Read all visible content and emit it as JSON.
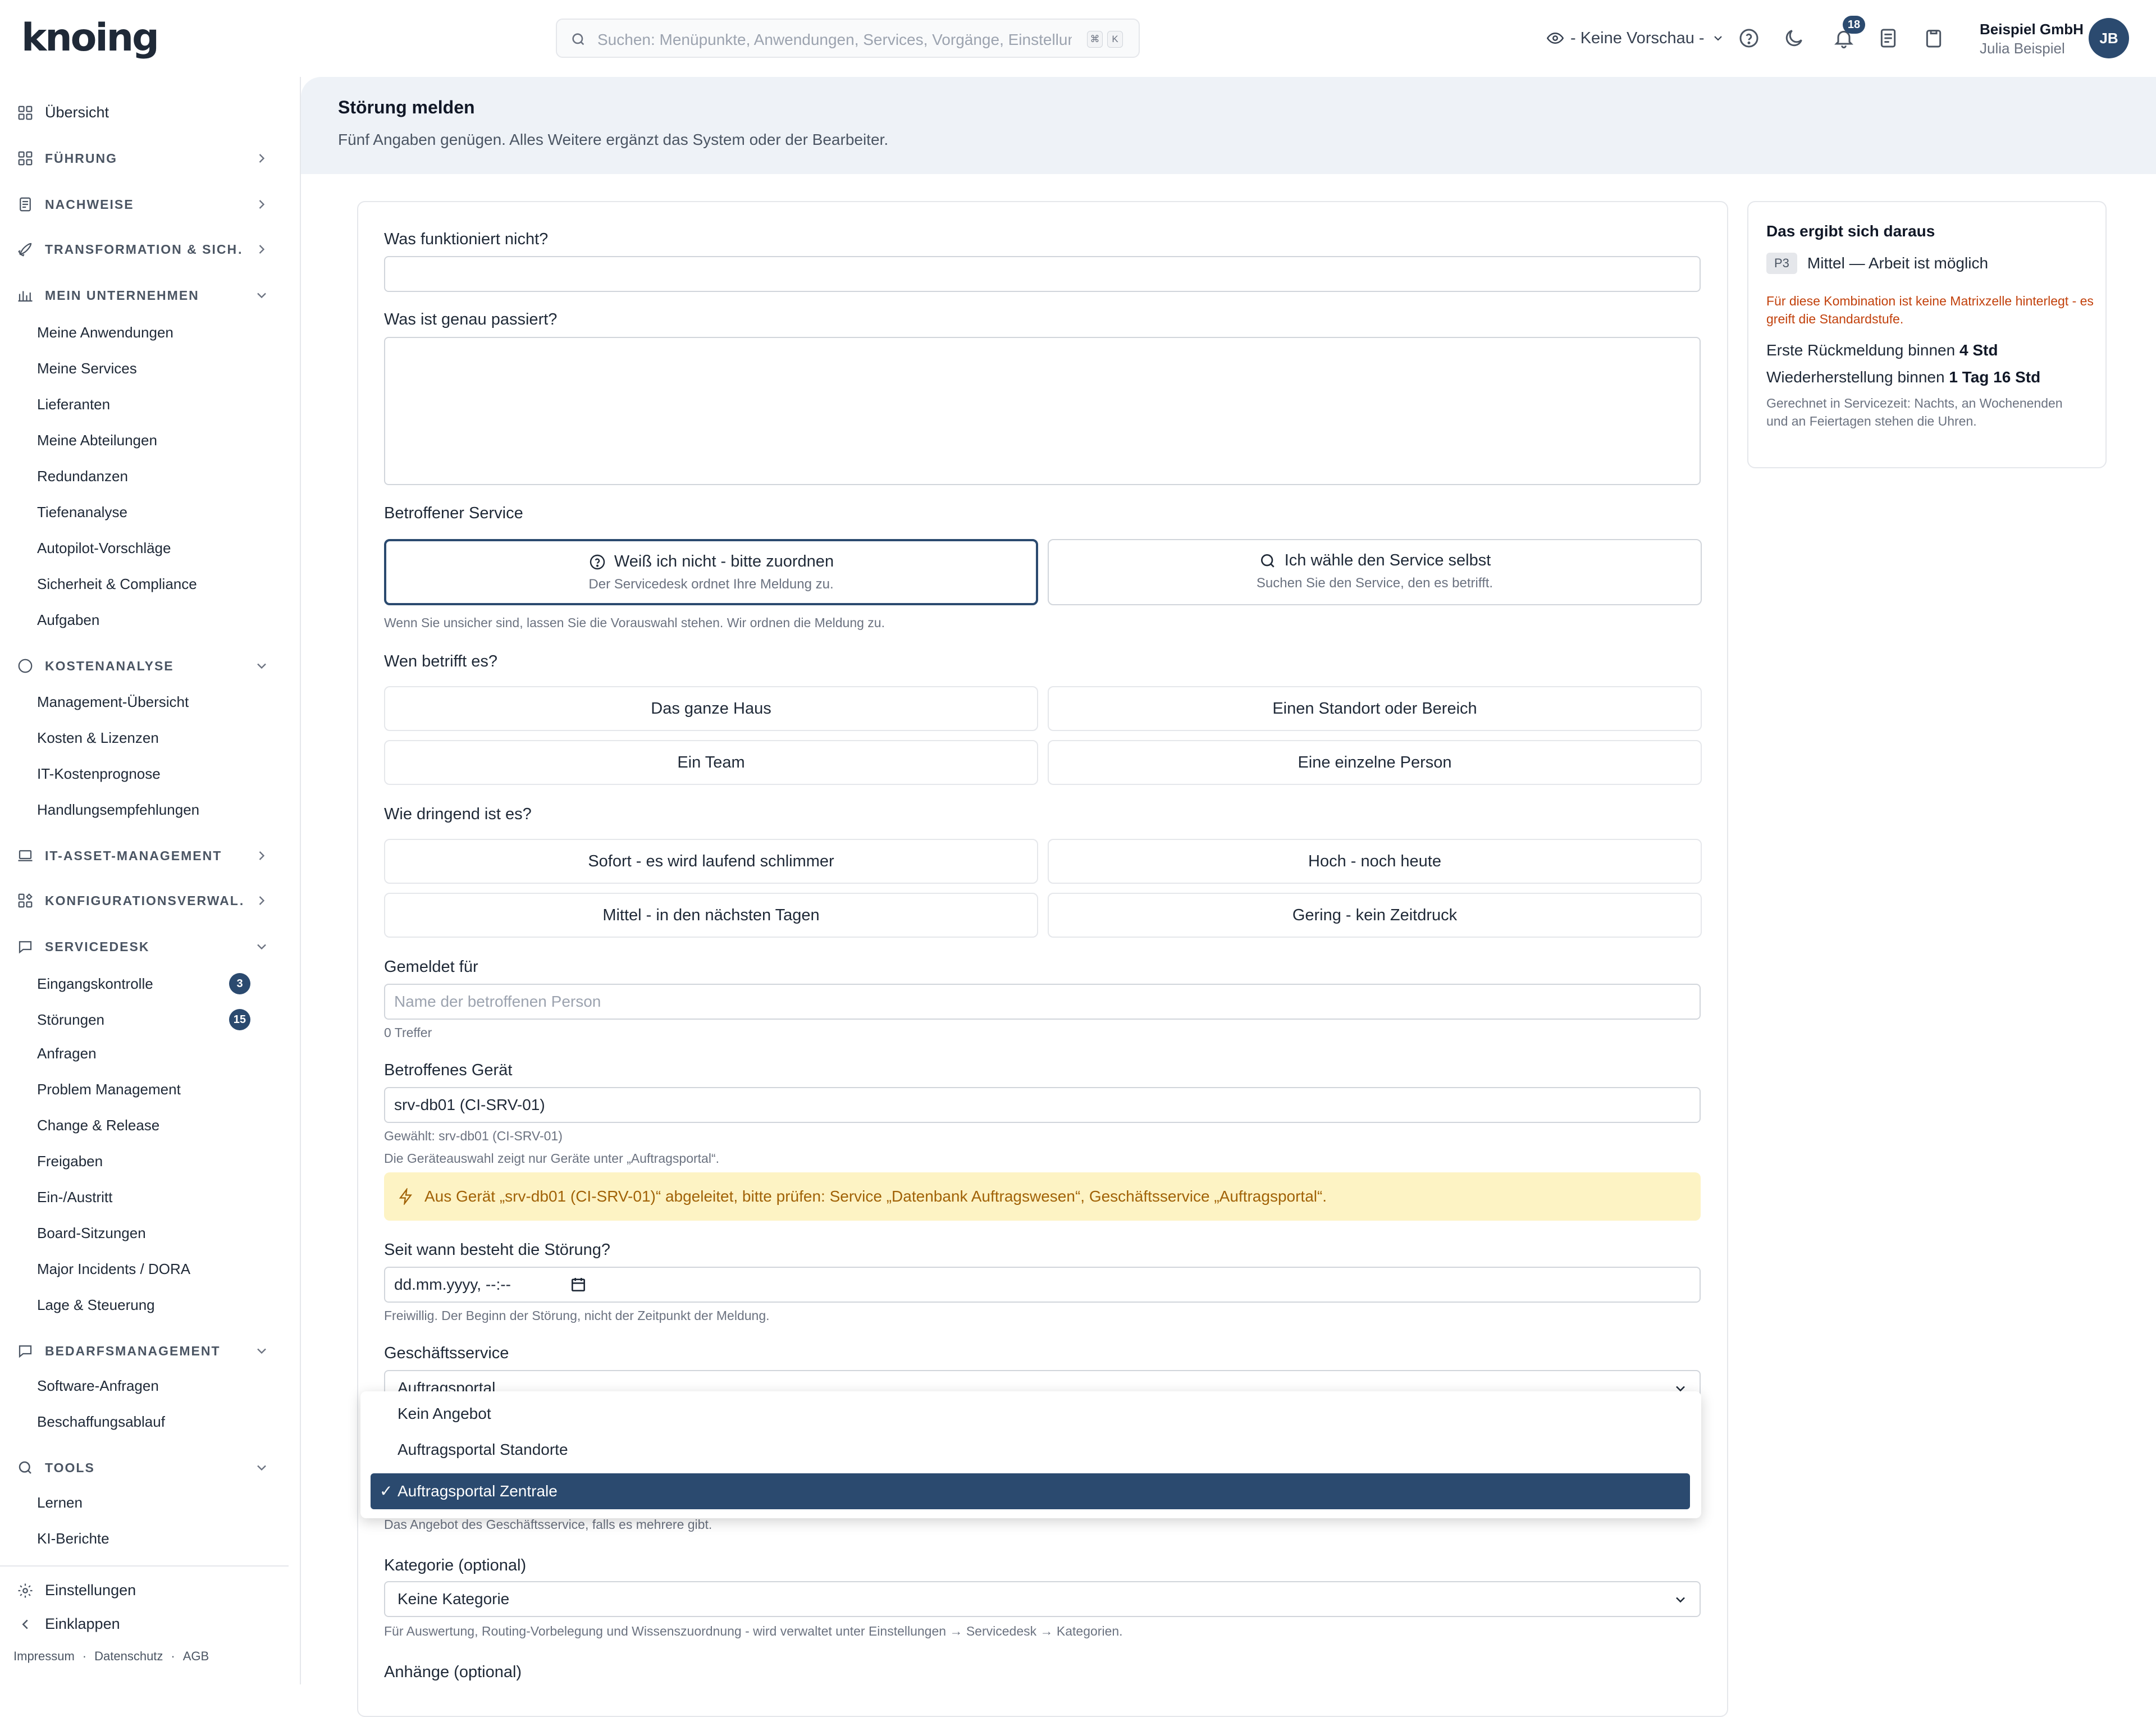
{
  "header": {
    "logo": "knoing",
    "search_placeholder": "Suchen: Menüpunkte, Anwendungen, Services, Vorgänge, Einstellungen",
    "search_kbd_1": "⌘",
    "search_kbd_2": "K",
    "preview_label": "- Keine Vorschau -",
    "notification_count": "18",
    "company": "Beispiel GmbH",
    "user_name": "Julia Beispiel",
    "avatar_initials": "JB"
  },
  "sidebar": {
    "overview": "Übersicht",
    "sections": {
      "fuehrung": "FÜHRUNG",
      "nachweise": "NACHWEISE",
      "transformation": "TRANSFORMATION & SICH…",
      "mein_unternehmen": "MEIN UNTERNEHMEN",
      "kostenanalyse": "KOSTENANALYSE",
      "itam": "IT-ASSET-MANAGEMENT",
      "konfig": "KONFIGURATIONSVERWAL…",
      "servicedesk": "SERVICEDESK",
      "bedarf": "BEDARFSMANAGEMENT",
      "tools": "TOOLS"
    },
    "mein_unternehmen_items": [
      "Meine Anwendungen",
      "Meine Services",
      "Lieferanten",
      "Meine Abteilungen",
      "Redundanzen",
      "Tiefenanalyse",
      "Autopilot-Vorschläge",
      "Sicherheit & Compliance",
      "Aufgaben"
    ],
    "kosten_items": [
      "Management-Übersicht",
      "Kosten & Lizenzen",
      "IT-Kostenprognose",
      "Handlungsempfehlungen"
    ],
    "servicedesk_items": [
      "Eingangskontrolle",
      "Störungen",
      "Anfragen",
      "Problem Management",
      "Change & Release",
      "Freigaben",
      "Ein-/Austritt",
      "Board-Sitzungen",
      "Major Incidents / DORA",
      "Lage & Steuerung"
    ],
    "servicedesk_counts": {
      "eingangskontrolle": "3",
      "stoerungen": "15"
    },
    "bedarf_items": [
      "Software-Anfragen",
      "Beschaffungsablauf"
    ],
    "tools_items": [
      "Lernen",
      "KI-Berichte"
    ],
    "settings": "Einstellungen",
    "collapse": "Einklappen",
    "legal": [
      "Impressum",
      "·",
      "Datenschutz",
      "·",
      "AGB"
    ]
  },
  "page": {
    "title": "Störung melden",
    "subtitle": "Fünf Angaben genügen. Alles Weitere ergänzt das System oder der Bearbeiter."
  },
  "form": {
    "q_what_label": "Was funktioniert nicht?",
    "q_detail_label": "Was ist genau passiert?",
    "service_label": "Betroffener Service",
    "service_opt1_title": "Weiß ich nicht - bitte zuordnen",
    "service_opt1_sub": "Der Servicedesk ordnet Ihre Meldung zu.",
    "service_opt2_title": "Ich wähle den Service selbst",
    "service_opt2_sub": "Suchen Sie den Service, den es betrifft.",
    "service_hint": "Wenn Sie unsicher sind, lassen Sie die Vorauswahl stehen. Wir ordnen die Meldung zu.",
    "scope_label": "Wen betrifft es?",
    "scope_options": [
      "Das ganze Haus",
      "Einen Standort oder Bereich",
      "Ein Team",
      "Eine einzelne Person"
    ],
    "urgency_label": "Wie dringend ist es?",
    "urgency_options": [
      "Sofort - es wird laufend schlimmer",
      "Hoch - noch heute",
      "Mittel - in den nächsten Tagen",
      "Gering - kein Zeitdruck"
    ],
    "reported_for_label": "Gemeldet für",
    "reported_for_placeholder": "Name der betroffenen Person",
    "reported_for_hits": "0 Treffer",
    "device_label": "Betroffenes Gerät",
    "device_value": "srv-db01 (CI-SRV-01)",
    "device_selected": "Gewählt: srv-db01 (CI-SRV-01)",
    "device_note": "Die Geräteauswahl zeigt nur Geräte unter „Auftragsportal“.",
    "device_alert": "Aus Gerät „srv-db01 (CI-SRV-01)“ abgeleitet, bitte prüfen: Service „Datenbank Auftragswesen“, Geschäftsservice „Auftragsportal“.",
    "since_label": "Seit wann besteht die Störung?",
    "since_value": "dd.mm.yyyy, --:--",
    "since_hint": "Freiwillig. Der Beginn der Störung, nicht der Zeitpunkt der Meldung.",
    "biz_service_label": "Geschäftsservice",
    "biz_service_value": "Auftragsportal",
    "offer_options": [
      "Kein Angebot",
      "Auftragsportal Standorte",
      "Auftragsportal Zentrale"
    ],
    "offer_selected": "Auftragsportal Zentrale",
    "offer_hint": "Das Angebot des Geschäftsservice, falls es mehrere gibt.",
    "category_label": "Kategorie (optional)",
    "category_value": "Keine Kategorie",
    "category_hint": "Für Auswertung, Routing-Vorbelegung und Wissenszuordnung - wird verwaltet unter Einstellungen → Servicedesk → Kategorien.",
    "attachments_label": "Anhänge (optional)"
  },
  "summary": {
    "title": "Das ergibt sich daraus",
    "priority_code": "P3",
    "priority_text": "Mittel — Arbeit ist möglich",
    "warning": "Für diese Kombination ist keine Matrixzelle hinterlegt - es greift die Standardstufe.",
    "first_response_label": "Erste Rückmeldung binnen",
    "first_response_value": "4 Std",
    "restore_label": "Wiederherstellung binnen",
    "restore_value": "1 Tag 16 Std",
    "note": "Gerechnet in Servicezeit: Nachts, an Wochenenden und an Feiertagen stehen die Uhren."
  },
  "colors": {
    "primary": "#2b4a6f",
    "alert_bg": "#fdf3c4",
    "alert_text": "#a16207",
    "warning_text": "#c2410c",
    "header_bg": "#eef2f7"
  }
}
